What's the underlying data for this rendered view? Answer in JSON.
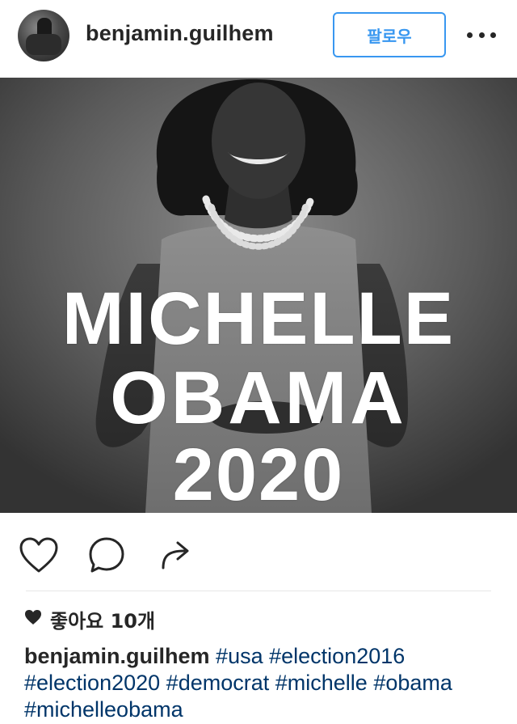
{
  "post": {
    "username": "benjamin.guilhem",
    "follow_label": "팔로우",
    "image": {
      "overlay_lines": [
        "MICHELLE",
        "OBAMA",
        "2020"
      ]
    },
    "likes_text": "좋아요 10개",
    "caption": {
      "username": "benjamin.guilhem",
      "tags": [
        "#usa",
        "#election2016",
        "#election2020",
        "#democrat",
        "#michelle",
        "#obama",
        "#michelleobama"
      ]
    }
  },
  "icons": {
    "more": "more-options-icon",
    "like": "heart-icon",
    "comment": "comment-icon",
    "share": "share-icon",
    "likes": "heart-filled-icon"
  },
  "colors": {
    "accent": "#3897f0",
    "hashtag": "#003569",
    "text": "#262626"
  }
}
